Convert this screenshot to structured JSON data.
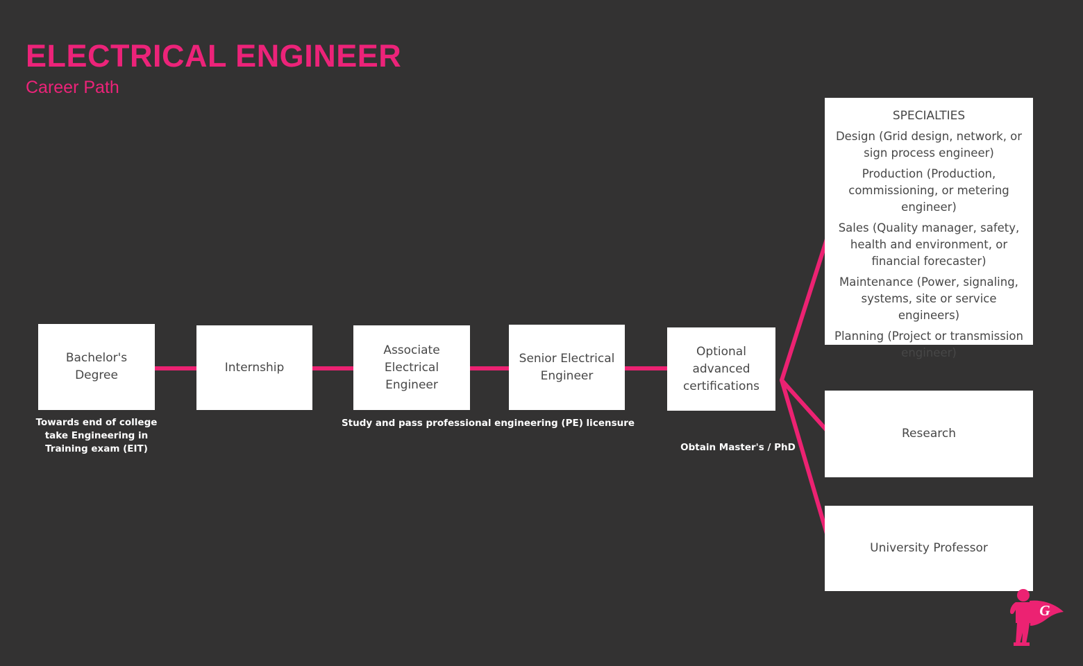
{
  "header": {
    "title": "ELECTRICAL ENGINEER",
    "subtitle": "Career Path"
  },
  "colors": {
    "background": "#333232",
    "accent_pink": "#ec2379",
    "line_pink": "#ec2272",
    "box_background": "#ffffff",
    "box_text": "#474747",
    "caption_text": "#ffffff"
  },
  "path_nodes": [
    {
      "label": "Bachelor's  Degree"
    },
    {
      "label": "Internship"
    },
    {
      "label": "Associate\nElectrical Engineer"
    },
    {
      "label": "Senior Electrical\nEngineer"
    },
    {
      "label": "Optional advanced\ncertifications"
    }
  ],
  "captions": [
    {
      "text": "Towards end of college\ntake Engineering in\nTraining exam (EIT)"
    },
    {
      "text": "Study and pass professional engineering (PE) licensure"
    },
    {
      "text": "Obtain Master's  / PhD"
    }
  ],
  "specialties": {
    "title": "SPECIALTIES",
    "items": [
      "Design (Grid design, network, or sign process engineer)",
      "Production (Production, commissioning, or metering engineer)",
      "Sales (Quality manager, safety, health and environment, or financial forecaster)",
      "Maintenance (Power, signaling, systems, site or service engineers)",
      "Planning (Project or transmission engineer)"
    ]
  },
  "outcome_nodes": [
    {
      "label": "Research"
    },
    {
      "label": "University Professor"
    }
  ],
  "logo": {
    "letter": "G",
    "name": "superhero-g-logo"
  }
}
